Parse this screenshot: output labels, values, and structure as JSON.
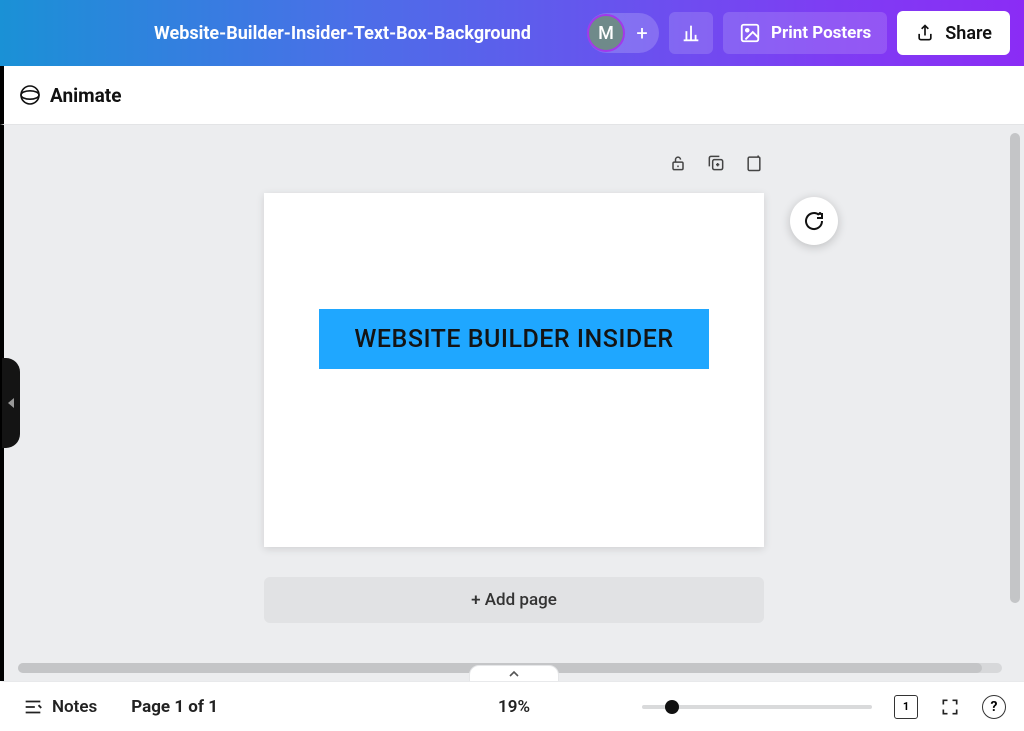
{
  "header": {
    "doc_title": "Website-Builder-Insider-Text-Box-Background",
    "avatar_initial": "M",
    "print_label": "Print Posters",
    "share_label": "Share"
  },
  "toolbar": {
    "animate_label": "Animate"
  },
  "canvas": {
    "text_content": "WEBSITE BUILDER INSIDER",
    "text_bg_color": "#1fa7ff"
  },
  "add_page_label": "+ Add page",
  "footer": {
    "notes_label": "Notes",
    "page_indicator": "Page 1 of 1",
    "zoom_label": "19%",
    "grid_count": "1"
  }
}
